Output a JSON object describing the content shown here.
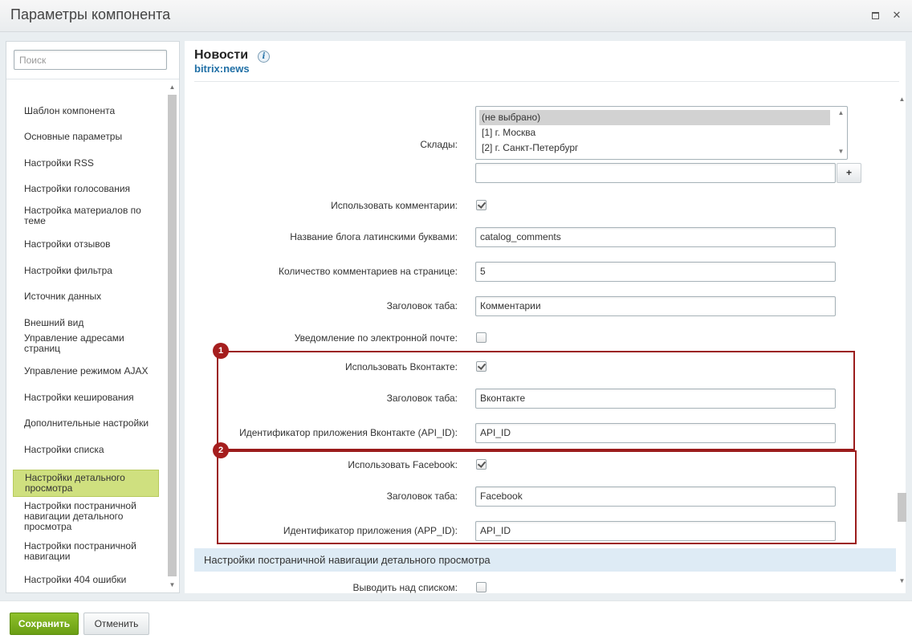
{
  "window": {
    "title": "Параметры компонента",
    "restore_icon": "restore-icon",
    "close_icon": "close-icon",
    "close_glyph": "✕"
  },
  "search": {
    "placeholder": "Поиск",
    "value": ""
  },
  "sidebar": {
    "items": [
      {
        "label": "Шаблон компонента"
      },
      {
        "label": "Основные параметры"
      },
      {
        "label": "Настройки RSS"
      },
      {
        "label": "Настройки голосования"
      },
      {
        "label": "Настройка материалов по теме"
      },
      {
        "label": "Настройки отзывов"
      },
      {
        "label": "Настройки фильтра"
      },
      {
        "label": "Источник данных"
      },
      {
        "label": "Внешний вид"
      },
      {
        "label": "Управление адресами страниц"
      },
      {
        "label": "Управление режимом AJAX"
      },
      {
        "label": "Настройки кеширования"
      },
      {
        "label": "Дополнительные настройки"
      },
      {
        "label": "Настройки списка"
      },
      {
        "label": "Настройки детального просмотра",
        "active": true
      },
      {
        "label": "Настройки постраничной навигации детального просмотра"
      },
      {
        "label": "Настройки постраничной навигации"
      },
      {
        "label": "Настройки 404 ошибки"
      }
    ]
  },
  "component": {
    "title": "Новости",
    "code": "bitrix:news",
    "info_glyph": "i"
  },
  "fields": {
    "warehouses": {
      "label": "Склады:",
      "options": [
        "(не выбрано)",
        "[1] г. Москва",
        "[2] г. Санкт-Петербург"
      ],
      "selected": "(не выбрано)",
      "extra_value": "",
      "plus_label": "+"
    },
    "use_comments": {
      "label": "Использовать комментарии:",
      "checked": true
    },
    "blog_name": {
      "label": "Название блога латинскими буквами:",
      "value": "catalog_comments"
    },
    "comments_per_page": {
      "label": "Количество комментариев на странице:",
      "value": "5"
    },
    "tab_title": {
      "label": "Заголовок таба:",
      "value": "Комментарии"
    },
    "email_notify": {
      "label": "Уведомление по электронной почте:",
      "checked": false
    },
    "use_vk": {
      "label": "Использовать Вконтакте:",
      "checked": true
    },
    "vk_tab_title": {
      "label": "Заголовок таба:",
      "value": "Вконтакте"
    },
    "vk_api_id": {
      "label": "Идентификатор приложения Вконтакте (API_ID):",
      "value": "API_ID"
    },
    "use_fb": {
      "label": "Использовать Facebook:",
      "checked": true
    },
    "fb_tab_title": {
      "label": "Заголовок таба:",
      "value": "Facebook"
    },
    "fb_app_id": {
      "label": "Идентификатор приложения (APP_ID):",
      "value": "API_ID"
    },
    "show_above_list": {
      "label": "Выводить над списком:",
      "checked": false
    }
  },
  "badges": {
    "first": "1",
    "second": "2"
  },
  "section_heading": "Настройки постраничной навигации детального просмотра",
  "footer": {
    "save_label": "Сохранить",
    "cancel_label": "Отменить"
  },
  "colors": {
    "save_button": "#7aae1c",
    "active_nav": "#cfe07f",
    "highlight": "#9b1c1c",
    "link": "#2170a6"
  }
}
